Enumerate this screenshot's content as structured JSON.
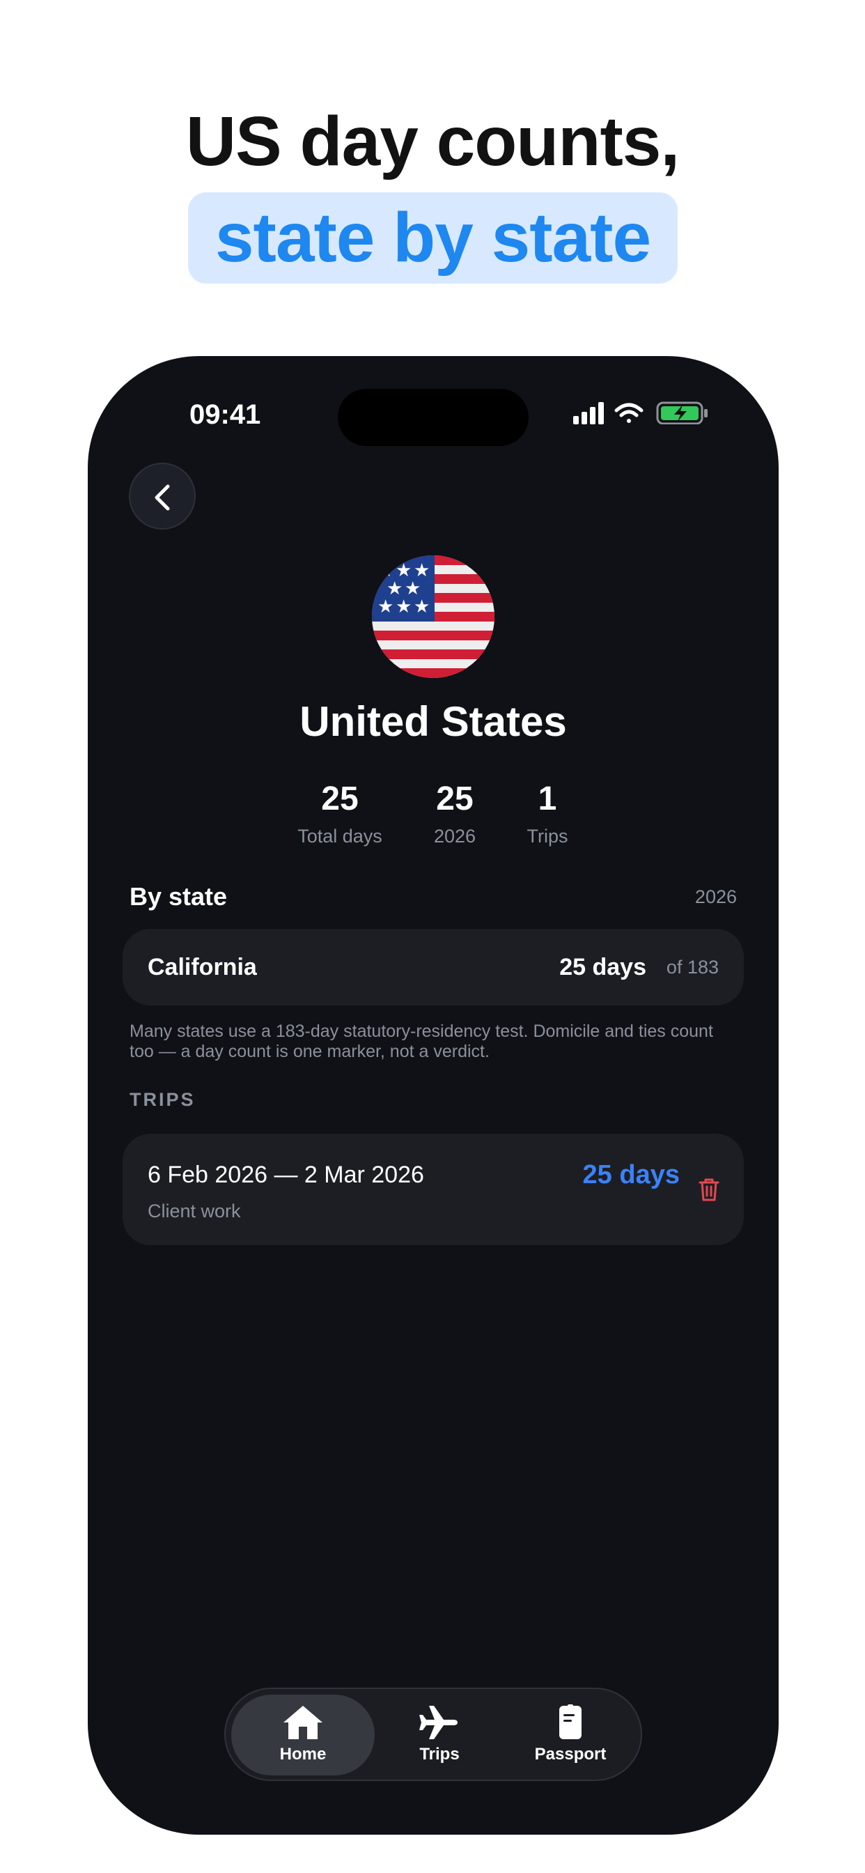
{
  "headline": {
    "line1": "US day counts,",
    "line2": "state by state"
  },
  "status_bar": {
    "time": "09:41",
    "icons": [
      "signal-icon",
      "wifi-icon",
      "battery-charging-icon"
    ]
  },
  "country": {
    "name": "United States",
    "flag": "us-flag-icon"
  },
  "stats": [
    {
      "value": "25",
      "label": "Total days"
    },
    {
      "value": "25",
      "label": "2026"
    },
    {
      "value": "1",
      "label": "Trips"
    }
  ],
  "by_state": {
    "title": "By state",
    "year": "2026",
    "rows": [
      {
        "state": "California",
        "days": "25 days",
        "of": "of 183"
      }
    ],
    "note": "Many states use a 183-day statutory-residency test. Domicile and ties count too — a day count is one marker, not a verdict."
  },
  "trips": {
    "label": "TRIPS",
    "items": [
      {
        "dates": "6 Feb 2026 — 2 Mar 2026",
        "note": "Client work",
        "days": "25 days"
      }
    ]
  },
  "tabbar": {
    "active": "Home",
    "tabs": [
      {
        "label": "Home",
        "icon": "home-icon"
      },
      {
        "label": "Trips",
        "icon": "airplane-icon"
      },
      {
        "label": "Passport",
        "icon": "passport-icon"
      }
    ]
  },
  "colors": {
    "accent": "#3b82f6",
    "headline_blue": "#1e87f0",
    "highlight_bg": "#d8e9ff",
    "background": "#0f1116",
    "danger": "#e5484d"
  }
}
